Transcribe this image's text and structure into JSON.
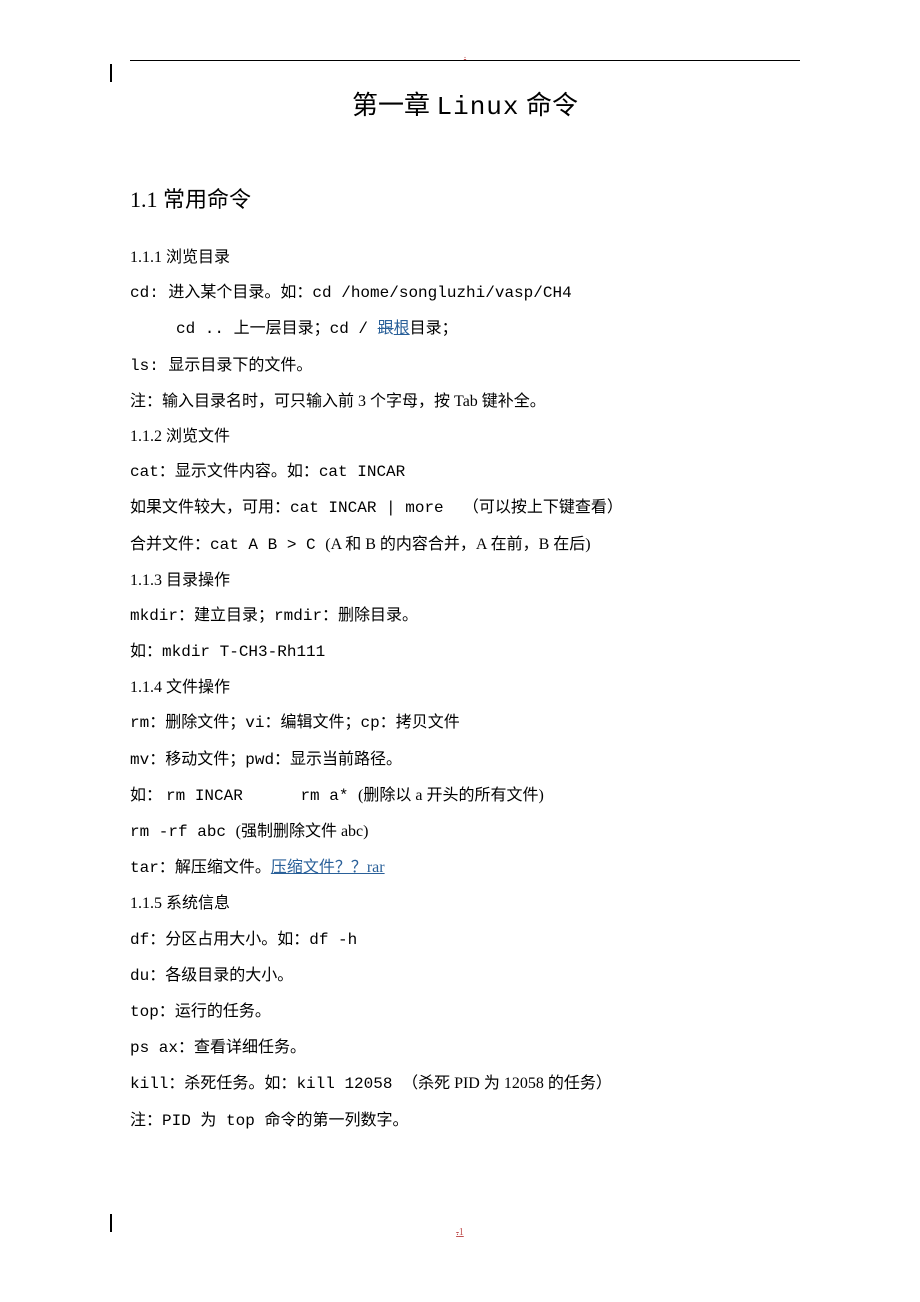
{
  "header": {
    "dot": "."
  },
  "title": {
    "prefix": "第一章 ",
    "mono": "Linux",
    "suffix": " 命令"
  },
  "section": "1.1 常用命令",
  "lines": {
    "l01": "1.1.1 浏览目录",
    "l02a": "cd: ",
    "l02b": "进入某个目录。如：",
    "l02c": "cd /home/songluzhi/vasp/CH4",
    "l03a": "cd .. ",
    "l03b": "上一层目录；",
    "l03c": "cd / ",
    "l03strike": "跟",
    "l03ins": "根",
    "l03d": "目录；",
    "l04a": "ls: ",
    "l04b": "显示目录下的文件。",
    "l05a": "注：输入目录名时，可只输入前",
    "l05b": " 3 ",
    "l05c": "个字母，按",
    "l05d": " Tab ",
    "l05e": "键补全。",
    "l06": "1.1.2 浏览文件",
    "l07a": "cat：",
    "l07b": "显示文件内容。如：",
    "l07c": "cat INCAR",
    "l08a": "如果文件较大，可用：",
    "l08b": "cat INCAR | more  ",
    "l08c": "（可以按上下键查看）",
    "l09a": "合并文件：",
    "l09b": "cat A B > C ",
    "l09c": "(A 和 B 的内容合并，A 在前，B 在后)",
    "l10": "1.1.3 目录操作",
    "l11a": "mkdir：",
    "l11b": "建立目录；",
    "l11c": "rmdir：",
    "l11d": "删除目录。",
    "l12a": "如：",
    "l12b": "mkdir T-CH3-Rh111",
    "l13": "1.1.4 文件操作",
    "l14a": "rm：",
    "l14b": "删除文件；",
    "l14c": "vi：",
    "l14d": "编辑文件；",
    "l14e": "cp：",
    "l14f": "拷贝文件",
    "l15a": "mv：",
    "l15b": "移动文件；",
    "l15c": "pwd：",
    "l15d": "显示当前路径。",
    "l16a": "如： ",
    "l16b": "rm INCAR      rm a* ",
    "l16c": "(删除以 a 开头的所有文件)",
    "l17a": "rm -rf abc ",
    "l17b": "(强制删除文件 abc)",
    "l18a": "tar：",
    "l18b": "解压缩文件。",
    "l18c": "压缩文件？？rar",
    "l19": "1.1.5 系统信息",
    "l20a": "df：",
    "l20b": "分区占用大小。如：",
    "l20c": "df -h",
    "l21a": "du：",
    "l21b": "各级目录的大小。",
    "l22a": "top：",
    "l22b": "运行的任务。",
    "l23a": "ps ax：",
    "l23b": "查看详细任务。",
    "l24a": "kill：",
    "l24b": "杀死任务。如：",
    "l24c": "kill 12058 ",
    "l24d": "（杀死 PID 为 12058 的任务）",
    "l25a": "注：",
    "l25b": "PID ",
    "l25c": "为",
    "l25d": " top ",
    "l25e": "命令的第一列数字。"
  },
  "footer": {
    "strike": ".",
    "num": "1"
  }
}
